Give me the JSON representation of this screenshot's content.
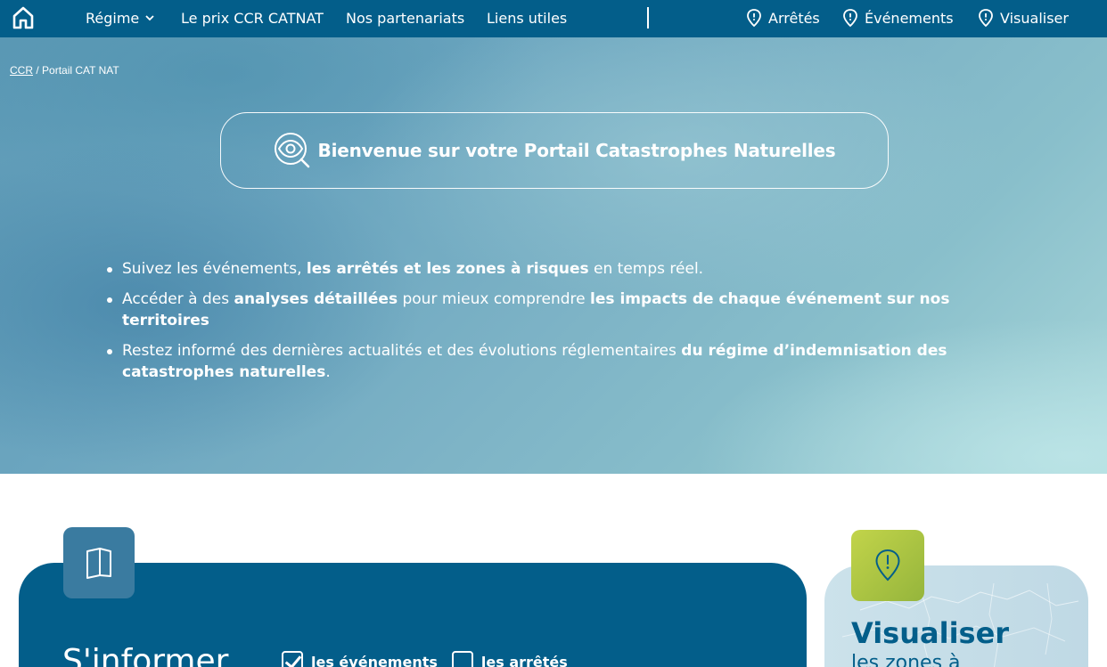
{
  "nav": {
    "items": [
      {
        "label": "Régime"
      },
      {
        "label": "Le prix CCR CATNAT"
      },
      {
        "label": "Nos partenariats"
      },
      {
        "label": "Liens utiles"
      }
    ],
    "right": [
      {
        "label": "Arrêtés"
      },
      {
        "label": "Événements"
      },
      {
        "label": "Visualiser"
      }
    ]
  },
  "breadcrumb": {
    "root": "CCR",
    "separator": " / ",
    "current": "Portail CAT NAT"
  },
  "hero": {
    "title": "Bienvenue sur votre Portail Catastrophes Naturelles",
    "bullets": [
      [
        {
          "t": "Suivez les événements, ",
          "b": false
        },
        {
          "t": "les arrêtés et les zones à risques",
          "b": true
        },
        {
          "t": " en temps réel.",
          "b": false
        }
      ],
      [
        {
          "t": "Accéder à des ",
          "b": false
        },
        {
          "t": "analyses détaillées",
          "b": true
        },
        {
          "t": " pour mieux comprendre ",
          "b": false
        },
        {
          "t": "les impacts de chaque événement sur nos territoires",
          "b": true
        }
      ],
      [
        {
          "t": "Restez informé des dernières actualités et des évolutions réglementaires ",
          "b": false
        },
        {
          "t": "du régime d’indemnisation des catastrophes naturelles",
          "b": true
        },
        {
          "t": ".",
          "b": false
        }
      ]
    ]
  },
  "informer": {
    "title": "S'informer",
    "filters": [
      {
        "label": "les événements",
        "checked": true
      },
      {
        "label": "les arrêtés",
        "checked": false
      }
    ]
  },
  "visualiser": {
    "title": "Visualiser",
    "subtitle": "les zones à"
  },
  "colors": {
    "primary": "#035e8a",
    "accent": "#a9c23f",
    "white": "#ffffff"
  }
}
